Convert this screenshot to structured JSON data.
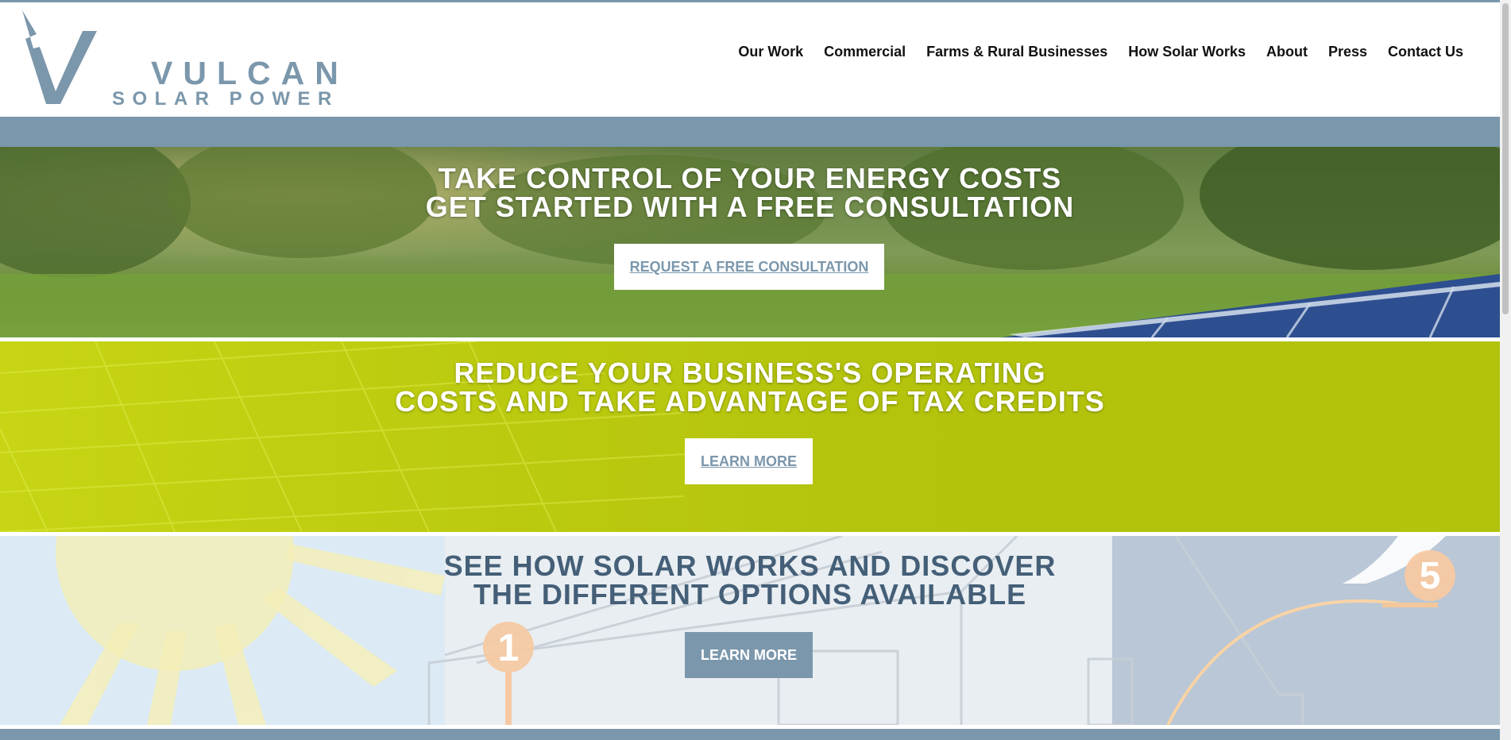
{
  "brand": {
    "name": "VULCAN",
    "tagline": "SOLAR POWER",
    "accent_color": "#7b97ac",
    "green_color": "#b3c30c",
    "slate_text_color": "#445f77"
  },
  "nav": {
    "items": [
      {
        "label": "Our Work"
      },
      {
        "label": "Commercial"
      },
      {
        "label": "Farms & Rural Businesses"
      },
      {
        "label": "How Solar Works"
      },
      {
        "label": "About"
      },
      {
        "label": "Press"
      },
      {
        "label": "Contact Us"
      }
    ]
  },
  "hero1": {
    "line1": "TAKE CONTROL OF YOUR ENERGY COSTS",
    "line2": "GET STARTED WITH A FREE CONSULTATION",
    "cta": "REQUEST A FREE CONSULTATION"
  },
  "hero2": {
    "line1": "REDUCE YOUR BUSINESS'S OPERATING",
    "line2": "COSTS AND TAKE ADVANTAGE OF TAX CREDITS",
    "cta": "LEARN MORE"
  },
  "hero3": {
    "line1": "SEE HOW SOLAR WORKS AND DISCOVER",
    "line2": "THE DIFFERENT OPTIONS AVAILABLE",
    "cta": "LEARN MORE",
    "step_labels": [
      "1",
      "5"
    ]
  }
}
